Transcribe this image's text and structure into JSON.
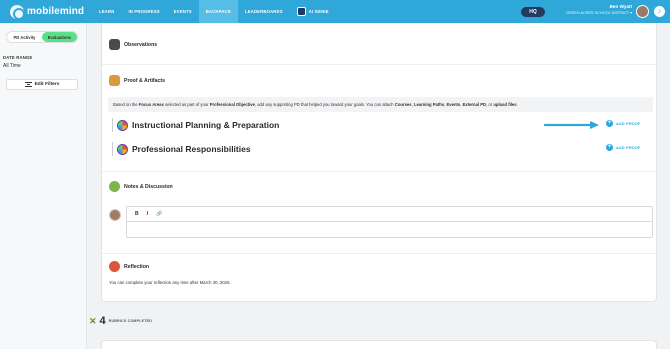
{
  "app": {
    "logo_text": "mobilemind"
  },
  "nav": {
    "items": [
      {
        "label": "LEARN"
      },
      {
        "label": "IN PROGRESS"
      },
      {
        "label": "EVENTS"
      },
      {
        "label": "BACKPACK"
      },
      {
        "label": "LEADERBOARDS"
      },
      {
        "label": "AI GENIE"
      }
    ],
    "active": "BACKPACK",
    "hq_label": "HQ"
  },
  "user": {
    "name": "Ben Wyatt",
    "org": "GREEN ACRES SCHOOL DISTRICT"
  },
  "sidebar": {
    "toggle": [
      "PD Activity",
      "Evaluations"
    ],
    "toggle_active": "Evaluations",
    "date_range_label": "DATE RANGE",
    "date_range_value": "All Time",
    "edit_filters_label": "Edit Filters"
  },
  "sections": {
    "observations": "Observations",
    "proof": "Proof & Artifacts",
    "notes": "Notes & Discussion",
    "reflection": "Reflection"
  },
  "proof_info": {
    "p1": "Based on the ",
    "b1": "Focus Areas",
    "p2": " selected as part of your ",
    "b2": "Professional Objective",
    "p3": ", add any supporting PD that helped you toward your goals. You can attach ",
    "b3": "Courses",
    "p4": ", ",
    "b4": "Learning Paths",
    "p5": ", ",
    "b5": "Events",
    "p6": ", ",
    "b6": "External PD",
    "p7": ", or ",
    "b7": "upload files",
    "p8": "."
  },
  "focus_areas": [
    {
      "name": "Instructional Planning & Preparation",
      "action": "ADD PROOF"
    },
    {
      "name": "Professional Responsibilities",
      "action": "ADD PROOF"
    }
  ],
  "editor": {
    "bold": "B",
    "italic": "I",
    "link": "🔗"
  },
  "reflection_note": "You can complete your reflection any time after March 30, 2026.",
  "rubrics": {
    "count": "4",
    "label": "RUBRICS COMPLETED"
  },
  "colors": {
    "nav": "#2fa7d9",
    "accent_green": "#5be08a",
    "hq": "#223a5e"
  }
}
